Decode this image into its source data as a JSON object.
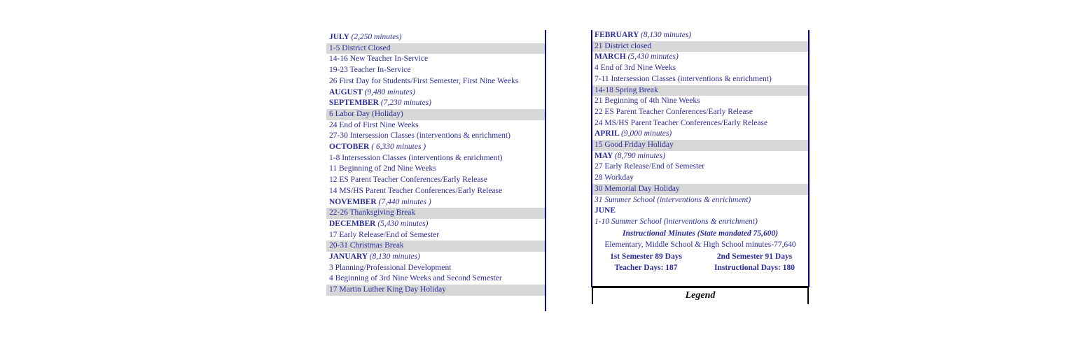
{
  "document": {
    "type": "school-district-academic-calendar-summary",
    "legend_label": "Legend"
  },
  "colors": {
    "text_navy": "#2b2b9e",
    "text_red": "#e8281e",
    "rule_navy": "#000080",
    "row_shade": "#d7d7d7",
    "row_plain": "#ffffff",
    "legend_border": "#000000"
  },
  "left_column": {
    "rows": [
      {
        "kind": "month",
        "month": "JULY",
        "minutes": "(2,250 minutes)",
        "shaded": false
      },
      {
        "kind": "event",
        "text": "1-5  District Closed",
        "shaded": true
      },
      {
        "kind": "event",
        "text": "14-16 New Teacher In-Service",
        "shaded": false
      },
      {
        "kind": "event",
        "text": "19-23 Teacher In-Service",
        "shaded": false
      },
      {
        "kind": "event",
        "text": "26 First Day for Students/First Semester, First Nine Weeks",
        "shaded": false
      },
      {
        "kind": "month",
        "month": "AUGUST",
        "minutes": "(9,480 minutes)",
        "shaded": false
      },
      {
        "kind": "month",
        "month": "SEPTEMBER",
        "minutes": "(7,230 minutes)",
        "shaded": false
      },
      {
        "kind": "event",
        "text": "6 Labor Day (Holiday)",
        "shaded": true
      },
      {
        "kind": "event",
        "text": "24 End of First Nine Weeks",
        "shaded": false
      },
      {
        "kind": "event",
        "text": "27-30 Intersession Classes (interventions & enrichment)",
        "shaded": false
      },
      {
        "kind": "month",
        "month": "OCTOBER",
        "minutes": "( 6,330 minutes )",
        "shaded": false
      },
      {
        "kind": "event",
        "text": "1-8 Intersession Classes (interventions & enrichment)",
        "shaded": false
      },
      {
        "kind": "event",
        "text": "11 Beginning of 2nd Nine Weeks",
        "shaded": false
      },
      {
        "kind": "event",
        "text": "12 ES Parent Teacher Conferences/Early Release",
        "shaded": false
      },
      {
        "kind": "event",
        "text": "14 MS/HS Parent Teacher Conferences/Early Release",
        "shaded": false
      },
      {
        "kind": "month",
        "month": "NOVEMBER",
        "minutes": "(7,440 minutes )",
        "shaded": false
      },
      {
        "kind": "event",
        "text": "22-26 Thanksgiving Break",
        "shaded": true
      },
      {
        "kind": "month",
        "month": "DECEMBER",
        "minutes": "(5,430 minutes)",
        "shaded": false
      },
      {
        "kind": "event",
        "text": "17 Early Release/End of Semester",
        "shaded": false
      },
      {
        "kind": "event",
        "text": "20-31 Christmas Break",
        "shaded": true
      },
      {
        "kind": "month",
        "month": "JANUARY",
        "minutes": "(8,130 minutes)",
        "shaded": false
      },
      {
        "kind": "event",
        "text": "3 Planning/Professional Development",
        "shaded": false
      },
      {
        "kind": "event",
        "text": "4 Beginning of 3rd Nine Weeks and Second Semester",
        "shaded": false
      },
      {
        "kind": "event",
        "text": "17 Martin Luther King Day Holiday",
        "shaded": true
      }
    ]
  },
  "right_column": {
    "rows": [
      {
        "kind": "month",
        "month": "FEBRUARY",
        "minutes": "(8,130 minutes)",
        "shaded": false
      },
      {
        "kind": "event",
        "text": "21 District closed",
        "shaded": true
      },
      {
        "kind": "month",
        "month": "MARCH",
        "minutes": " (5,430 minutes)",
        "shaded": false
      },
      {
        "kind": "event",
        "text": "4 End of 3rd Nine Weeks",
        "shaded": false
      },
      {
        "kind": "event",
        "text": "7-11 Intersession Classes (interventions & enrichment)",
        "shaded": false
      },
      {
        "kind": "event",
        "text": "14-18 Spring Break",
        "shaded": true
      },
      {
        "kind": "event",
        "text": "21 Beginning of 4th Nine Weeks",
        "shaded": false
      },
      {
        "kind": "event",
        "text": "22 ES Parent Teacher Conferences/Early Release",
        "shaded": false
      },
      {
        "kind": "event",
        "text": "24 MS/HS Parent Teacher Conferences/Early Release",
        "shaded": false
      },
      {
        "kind": "month",
        "month": "APRIL",
        "minutes": " (9,000 minutes)",
        "shaded": false
      },
      {
        "kind": "event",
        "text": "15 Good Friday Holiday",
        "shaded": true
      },
      {
        "kind": "month",
        "month": "MAY",
        "minutes": " (8,790 minutes)",
        "shaded": false
      },
      {
        "kind": "event",
        "text": "27 Early Release/End of Semester",
        "shaded": false
      },
      {
        "kind": "event",
        "text": "28 Workday",
        "shaded": false
      },
      {
        "kind": "event",
        "text": "30 Memorial Day Holiday",
        "shaded": true
      },
      {
        "kind": "event_italic",
        "text": "31 Summer School (interventions & enrichment)",
        "shaded": false
      },
      {
        "kind": "month",
        "month": "JUNE",
        "minutes": "",
        "shaded": false
      },
      {
        "kind": "event_italic",
        "text": "1-10 Summer School (interventions & enrichment)",
        "shaded": false
      }
    ],
    "summary": {
      "instructional_minutes_title": "Instructional Minutes (State mandated 75,600)",
      "school_minutes_line": "Elementary, Middle School & High School minutes-77,640",
      "semester1": "1st Semester 89 Days",
      "semester2": "2nd Semester 91 Days",
      "teacher_days": "Teacher Days: 187",
      "instructional_days": "Instructional Days: 180"
    }
  }
}
